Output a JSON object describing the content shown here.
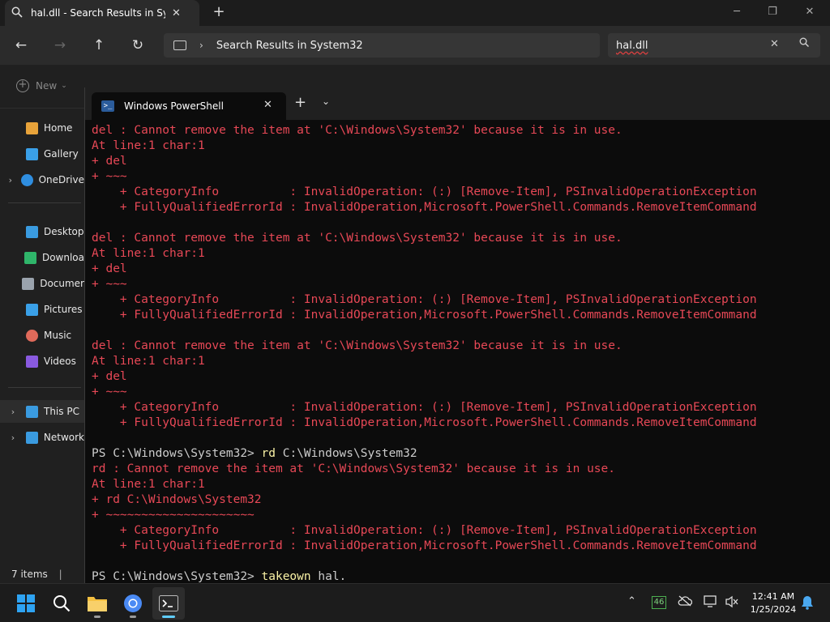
{
  "explorer": {
    "tab_title": "hal.dll - Search Results in Syste",
    "address_path": "Search Results in System32",
    "search_value": "hal.dll",
    "new_label": "New",
    "sidebar": [
      {
        "label": "Home",
        "icon": "home-icon",
        "color": "#e8a33a",
        "expand": false
      },
      {
        "label": "Gallery",
        "icon": "gallery-icon",
        "color": "#3aa0e8",
        "expand": false
      },
      {
        "label": "OneDrive",
        "icon": "cloud-icon",
        "color": "#2f8ee0",
        "expand": true
      },
      {
        "label": "Desktop",
        "icon": "desktop-icon",
        "color": "#3a9be0",
        "expand": false
      },
      {
        "label": "Downloa",
        "icon": "download-icon",
        "color": "#2fb56a",
        "expand": false
      },
      {
        "label": "Documer",
        "icon": "document-icon",
        "color": "#9aa3ad",
        "expand": false
      },
      {
        "label": "Pictures",
        "icon": "pictures-icon",
        "color": "#3aa0e8",
        "expand": false
      },
      {
        "label": "Music",
        "icon": "music-icon",
        "color": "#e06a5a",
        "expand": false
      },
      {
        "label": "Videos",
        "icon": "videos-icon",
        "color": "#8a5ae0",
        "expand": false
      },
      {
        "label": "This PC",
        "icon": "computer-icon",
        "color": "#3a9be0",
        "expand": true,
        "selected": true
      },
      {
        "label": "Network",
        "icon": "network-icon",
        "color": "#3a9be0",
        "expand": true
      }
    ],
    "status_items": "7 items"
  },
  "terminal": {
    "tab_title": "Windows PowerShell",
    "lines": [
      {
        "t": "del : Cannot remove the item at 'C:\\Windows\\System32' because it is in use.",
        "c": "err"
      },
      {
        "t": "At line:1 char:1",
        "c": "err"
      },
      {
        "t": "+ del",
        "c": "err"
      },
      {
        "t": "+ ~~~",
        "c": "err"
      },
      {
        "t": "    + CategoryInfo          : InvalidOperation: (:) [Remove-Item], PSInvalidOperationException",
        "c": "err"
      },
      {
        "t": "    + FullyQualifiedErrorId : InvalidOperation,Microsoft.PowerShell.Commands.RemoveItemCommand",
        "c": "err"
      },
      {
        "t": "",
        "c": "norm"
      },
      {
        "t": "del : Cannot remove the item at 'C:\\Windows\\System32' because it is in use.",
        "c": "err"
      },
      {
        "t": "At line:1 char:1",
        "c": "err"
      },
      {
        "t": "+ del",
        "c": "err"
      },
      {
        "t": "+ ~~~",
        "c": "err"
      },
      {
        "t": "    + CategoryInfo          : InvalidOperation: (:) [Remove-Item], PSInvalidOperationException",
        "c": "err"
      },
      {
        "t": "    + FullyQualifiedErrorId : InvalidOperation,Microsoft.PowerShell.Commands.RemoveItemCommand",
        "c": "err"
      },
      {
        "t": "",
        "c": "norm"
      },
      {
        "t": "del : Cannot remove the item at 'C:\\Windows\\System32' because it is in use.",
        "c": "err"
      },
      {
        "t": "At line:1 char:1",
        "c": "err"
      },
      {
        "t": "+ del",
        "c": "err"
      },
      {
        "t": "+ ~~~",
        "c": "err"
      },
      {
        "t": "    + CategoryInfo          : InvalidOperation: (:) [Remove-Item], PSInvalidOperationException",
        "c": "err"
      },
      {
        "t": "    + FullyQualifiedErrorId : InvalidOperation,Microsoft.PowerShell.Commands.RemoveItemCommand",
        "c": "err"
      },
      {
        "t": "",
        "c": "norm"
      },
      {
        "prompt": "PS C:\\Windows\\System32> ",
        "cmd": "rd",
        "args": " C:\\Windows\\System32"
      },
      {
        "t": "rd : Cannot remove the item at 'C:\\Windows\\System32' because it is in use.",
        "c": "err"
      },
      {
        "t": "At line:1 char:1",
        "c": "err"
      },
      {
        "t": "+ rd C:\\Windows\\System32",
        "c": "err"
      },
      {
        "t": "+ ~~~~~~~~~~~~~~~~~~~~~",
        "c": "err"
      },
      {
        "t": "    + CategoryInfo          : InvalidOperation: (:) [Remove-Item], PSInvalidOperationException",
        "c": "err"
      },
      {
        "t": "    + FullyQualifiedErrorId : InvalidOperation,Microsoft.PowerShell.Commands.RemoveItemCommand",
        "c": "err"
      },
      {
        "t": "",
        "c": "norm"
      },
      {
        "prompt": "PS C:\\Windows\\System32> ",
        "cmd": "takeown",
        "args": " hal."
      }
    ]
  },
  "taskbar": {
    "time": "12:41 AM",
    "date": "1/25/2024",
    "badge": "46"
  }
}
